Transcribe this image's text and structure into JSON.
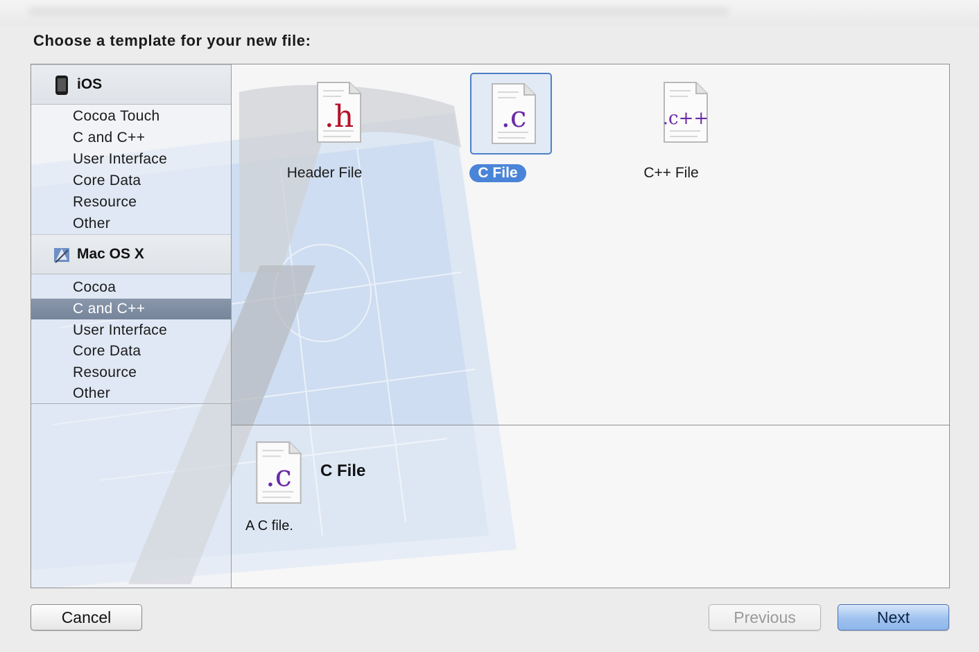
{
  "dialog": {
    "title": "Choose a template for your new file:"
  },
  "sidebar": {
    "groups": [
      {
        "label": "iOS",
        "icon": "iphone-icon",
        "items": [
          "Cocoa Touch",
          "C and C++",
          "User Interface",
          "Core Data",
          "Resource",
          "Other"
        ]
      },
      {
        "label": "Mac OS X",
        "icon": "mac-os-x-icon",
        "items": [
          "Cocoa",
          "C and C++",
          "User Interface",
          "Core Data",
          "Resource",
          "Other"
        ],
        "selected_item": "C and C++"
      }
    ]
  },
  "templates": [
    {
      "label": "Header File",
      "glyph": ".h",
      "glyph_color": "#b3122a",
      "icon": "header-file-icon"
    },
    {
      "label": "C File",
      "glyph": ".c",
      "glyph_color": "#6a2aa8",
      "icon": "c-file-icon",
      "selected": true
    },
    {
      "label": "C++ File",
      "glyph": ".c++",
      "glyph_color": "#6a2aa8",
      "icon": "cpp-file-icon"
    }
  ],
  "details": {
    "title": "C File",
    "description": "A C file.",
    "icon": "c-file-icon"
  },
  "buttons": {
    "cancel": "Cancel",
    "previous": "Previous",
    "next": "Next"
  },
  "colors": {
    "selection_blue": "#4a84d8",
    "sidebar_selection": "#7f8da2"
  }
}
